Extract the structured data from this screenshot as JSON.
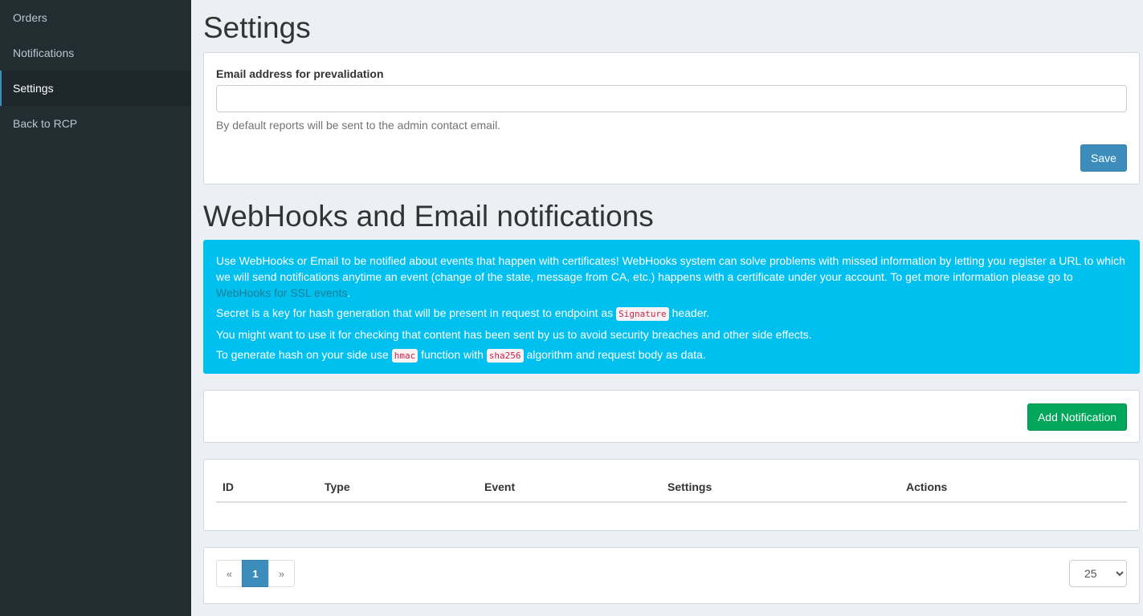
{
  "sidebar": {
    "items": [
      {
        "label": "Orders"
      },
      {
        "label": "Notifications"
      },
      {
        "label": "Settings"
      },
      {
        "label": "Back to RCP"
      }
    ],
    "active_index": 2
  },
  "settings": {
    "title": "Settings",
    "email_label": "Email address for prevalidation",
    "email_value": "",
    "help_text": "By default reports will be sent to the admin contact email.",
    "save_label": "Save"
  },
  "webhooks": {
    "title": "WebHooks and Email notifications",
    "info": {
      "p1_text": "Use WebHooks or Email to be notified about events that happen with certificates! WebHooks system can solve problems with missed information by letting you register a URL to which we will send notifications anytime an event (change of the state, message from CA, etc.) happens with a certificate under your account. To get more information please go to ",
      "p1_link": "WebHooks for SSL events",
      "p1_end": ".",
      "p2_before": "Secret is a key for hash generation that will be present in request to endpoint as ",
      "p2_code": "Signature",
      "p2_after": " header.",
      "p3": "You might want to use it for checking that content has been sent by us to avoid security breaches and other side effects.",
      "p4_before": "To generate hash on your side use ",
      "p4_code1": "hmac",
      "p4_mid": " function with ",
      "p4_code2": "sha256",
      "p4_after": " algorithm and request body as data."
    },
    "add_label": "Add Notification",
    "table": {
      "columns": [
        "ID",
        "Type",
        "Event",
        "Settings",
        "Actions"
      ]
    },
    "pagination": {
      "prev": "«",
      "current": "1",
      "next": "»",
      "per_page": "25",
      "per_page_options": [
        "25"
      ]
    }
  },
  "colors": {
    "sidebar_bg": "#222d32",
    "primary": "#3c8dbc",
    "success": "#00a65a",
    "info": "#00c0ef"
  }
}
